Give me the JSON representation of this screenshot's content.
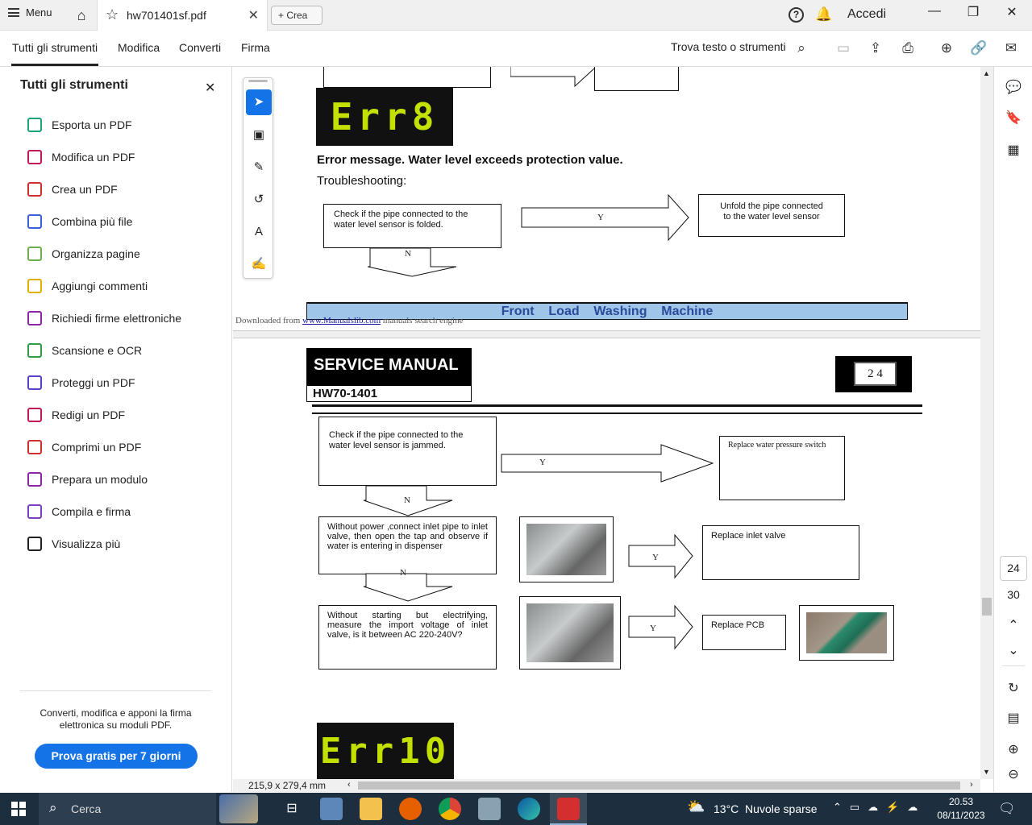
{
  "titlebar": {
    "menu_label": "Menu",
    "tab_title": "hw701401sf.pdf",
    "crea_label": "+ Crea",
    "accedi_label": "Accedi"
  },
  "tooltabs": [
    "Tutti gli strumenti",
    "Modifica",
    "Converti",
    "Firma"
  ],
  "find_label": "Trova testo o strumenti",
  "left_panel": {
    "title": "Tutti gli strumenti",
    "items": [
      {
        "label": "Esporta un PDF",
        "icon": "export-pdf-icon",
        "color": "#1aa37a"
      },
      {
        "label": "Modifica un PDF",
        "icon": "edit-pdf-icon",
        "color": "#c2185b"
      },
      {
        "label": "Crea un PDF",
        "icon": "create-pdf-icon",
        "color": "#d32f2f"
      },
      {
        "label": "Combina più file",
        "icon": "combine-files-icon",
        "color": "#3a5fd6"
      },
      {
        "label": "Organizza pagine",
        "icon": "organize-pages-icon",
        "color": "#6ab04c"
      },
      {
        "label": "Aggiungi commenti",
        "icon": "add-comment-icon",
        "color": "#e0b000"
      },
      {
        "label": "Richiedi firme elettroniche",
        "icon": "request-signature-icon",
        "color": "#8e24aa"
      },
      {
        "label": "Scansione e OCR",
        "icon": "scan-ocr-icon",
        "color": "#2e9e44"
      },
      {
        "label": "Proteggi un PDF",
        "icon": "protect-pdf-icon",
        "color": "#5b3fc4"
      },
      {
        "label": "Redigi un PDF",
        "icon": "redact-pdf-icon",
        "color": "#c2185b"
      },
      {
        "label": "Comprimi un PDF",
        "icon": "compress-pdf-icon",
        "color": "#d32f2f"
      },
      {
        "label": "Prepara un modulo",
        "icon": "prepare-form-icon",
        "color": "#8e24aa"
      },
      {
        "label": "Compila e firma",
        "icon": "fill-sign-icon",
        "color": "#7b3fc4"
      },
      {
        "label": "Visualizza più",
        "icon": "view-more-icon",
        "color": "#222222"
      }
    ],
    "promo_text": "Converti, modifica e apponi la firma elettronica su moduli PDF.",
    "cta_label": "Prova gratis per 7 giorni"
  },
  "document": {
    "page1": {
      "error_code": "Err8",
      "error_message": "Error message. Water level exceeds protection value.",
      "troubleshooting_label": "Troubleshooting:",
      "check_folded": "Check  if  the pipe  connected  to  the water level sensor is folded.",
      "yes_label": "Y",
      "no_label": "N",
      "unfold_action": "Unfold  the pipe  connected to the water level sensor",
      "footer_banner": "Front    Load    Washing    Machine",
      "downloaded_prefix": "Downloaded from",
      "downloaded_link": "www.Manualslib.com",
      "downloaded_suffix": "manuals search engine"
    },
    "page2": {
      "header_title": "SERVICE MANUAL",
      "header_model": "HW70-1401",
      "page_number": "2 4",
      "check_jammed": "Check  if  the pipe  connected  to  the water level sensor is jammed.",
      "replace_switch": "Replace water pressure switch",
      "without_power": "Without power ,connect inlet pipe to inlet valve, then open the tap and observe if water is entering in dispenser",
      "replace_valve": "Replace inlet valve",
      "without_starting": "Without starting but electrifying, measure the import voltage of inlet valve, is it between AC 220-240V?",
      "replace_pcb": "Replace PCB",
      "yes_label": "Y",
      "no_label": "N",
      "error_code_next": "Err10"
    }
  },
  "statusbar": {
    "page_size": "215,9 x 279,4 mm"
  },
  "rightrail": {
    "current_page": "24",
    "total_pages": "30"
  },
  "taskbar": {
    "search_label": "Cerca",
    "weather": "13°C  Nuvole sparse",
    "time": "20.53",
    "date": "08/11/2023"
  }
}
